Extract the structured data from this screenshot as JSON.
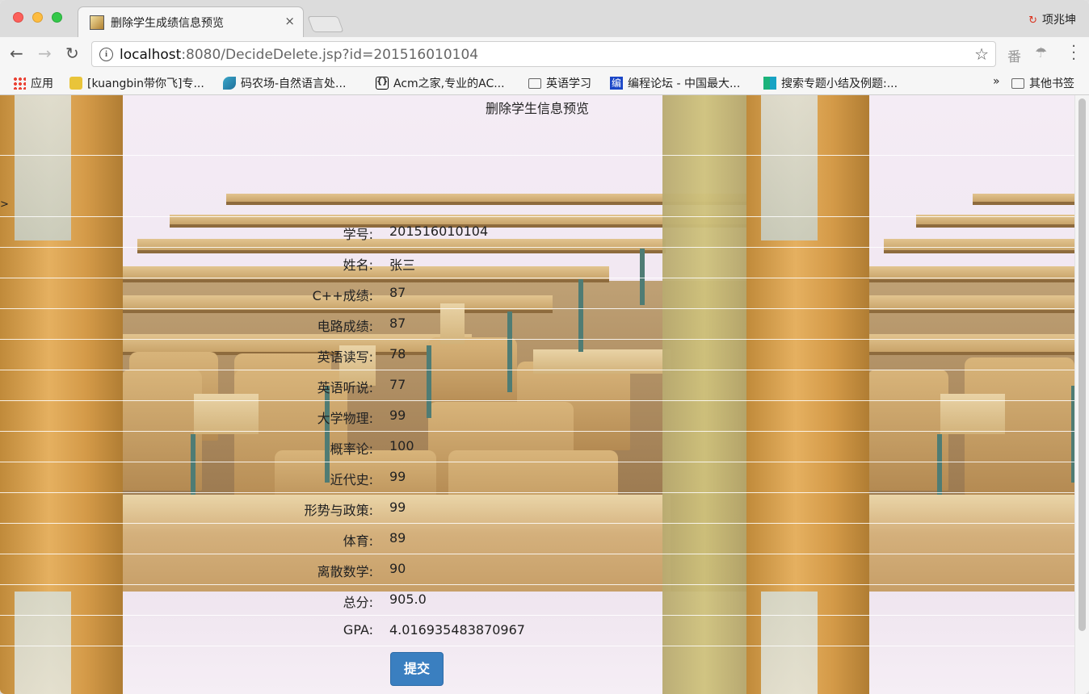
{
  "browser": {
    "tab_title": "删除学生成绩信息预览",
    "tab_close": "×",
    "profile_name": "项兆坤",
    "url_host": "localhost",
    "url_rest": ":8080/DecideDelete.jsp?id=201516010104",
    "icons": {
      "back": "back-arrow-icon",
      "forward": "forward-arrow-icon",
      "reload": "reload-icon",
      "info": "info-icon",
      "star": "bookmark-star-icon",
      "menu": "more-vert-icon"
    }
  },
  "bookmarks": {
    "items": [
      {
        "label": "应用",
        "icon": "apps-grid-icon"
      },
      {
        "label": "[kuangbin带你飞]专...",
        "icon": "yellow-face-icon"
      },
      {
        "label": "码农场-自然语言处...",
        "icon": "bird-icon"
      },
      {
        "label": "Acm之家,专业的AC...",
        "icon": "braces-icon"
      },
      {
        "label": "英语学习",
        "icon": "folder-icon"
      },
      {
        "label": "编程论坛 - 中国最大...",
        "icon": "bian-icon"
      },
      {
        "label": "搜索专题小结及例题:...",
        "icon": "green-logo-icon"
      }
    ],
    "overflow": "»",
    "other_label": "其他书签"
  },
  "page": {
    "heading": "删除学生信息预览",
    "stray_char": ">",
    "fields": [
      {
        "label": "学号:",
        "value": "201516010104"
      },
      {
        "label": "姓名:",
        "value": "张三"
      },
      {
        "label": "C++成绩:",
        "value": "87"
      },
      {
        "label": "电路成绩:",
        "value": "87"
      },
      {
        "label": "英语读写:",
        "value": "78"
      },
      {
        "label": "英语听说:",
        "value": "77"
      },
      {
        "label": "大学物理:",
        "value": "99"
      },
      {
        "label": "概率论:",
        "value": "100"
      },
      {
        "label": "近代史:",
        "value": "99"
      },
      {
        "label": "形势与政策:",
        "value": "99"
      },
      {
        "label": "体育:",
        "value": "89"
      },
      {
        "label": "离散数学:",
        "value": "90"
      },
      {
        "label": "总分:",
        "value": "905.0"
      },
      {
        "label": "GPA:",
        "value": "4.016935483870967"
      }
    ],
    "submit_label": "提交"
  }
}
